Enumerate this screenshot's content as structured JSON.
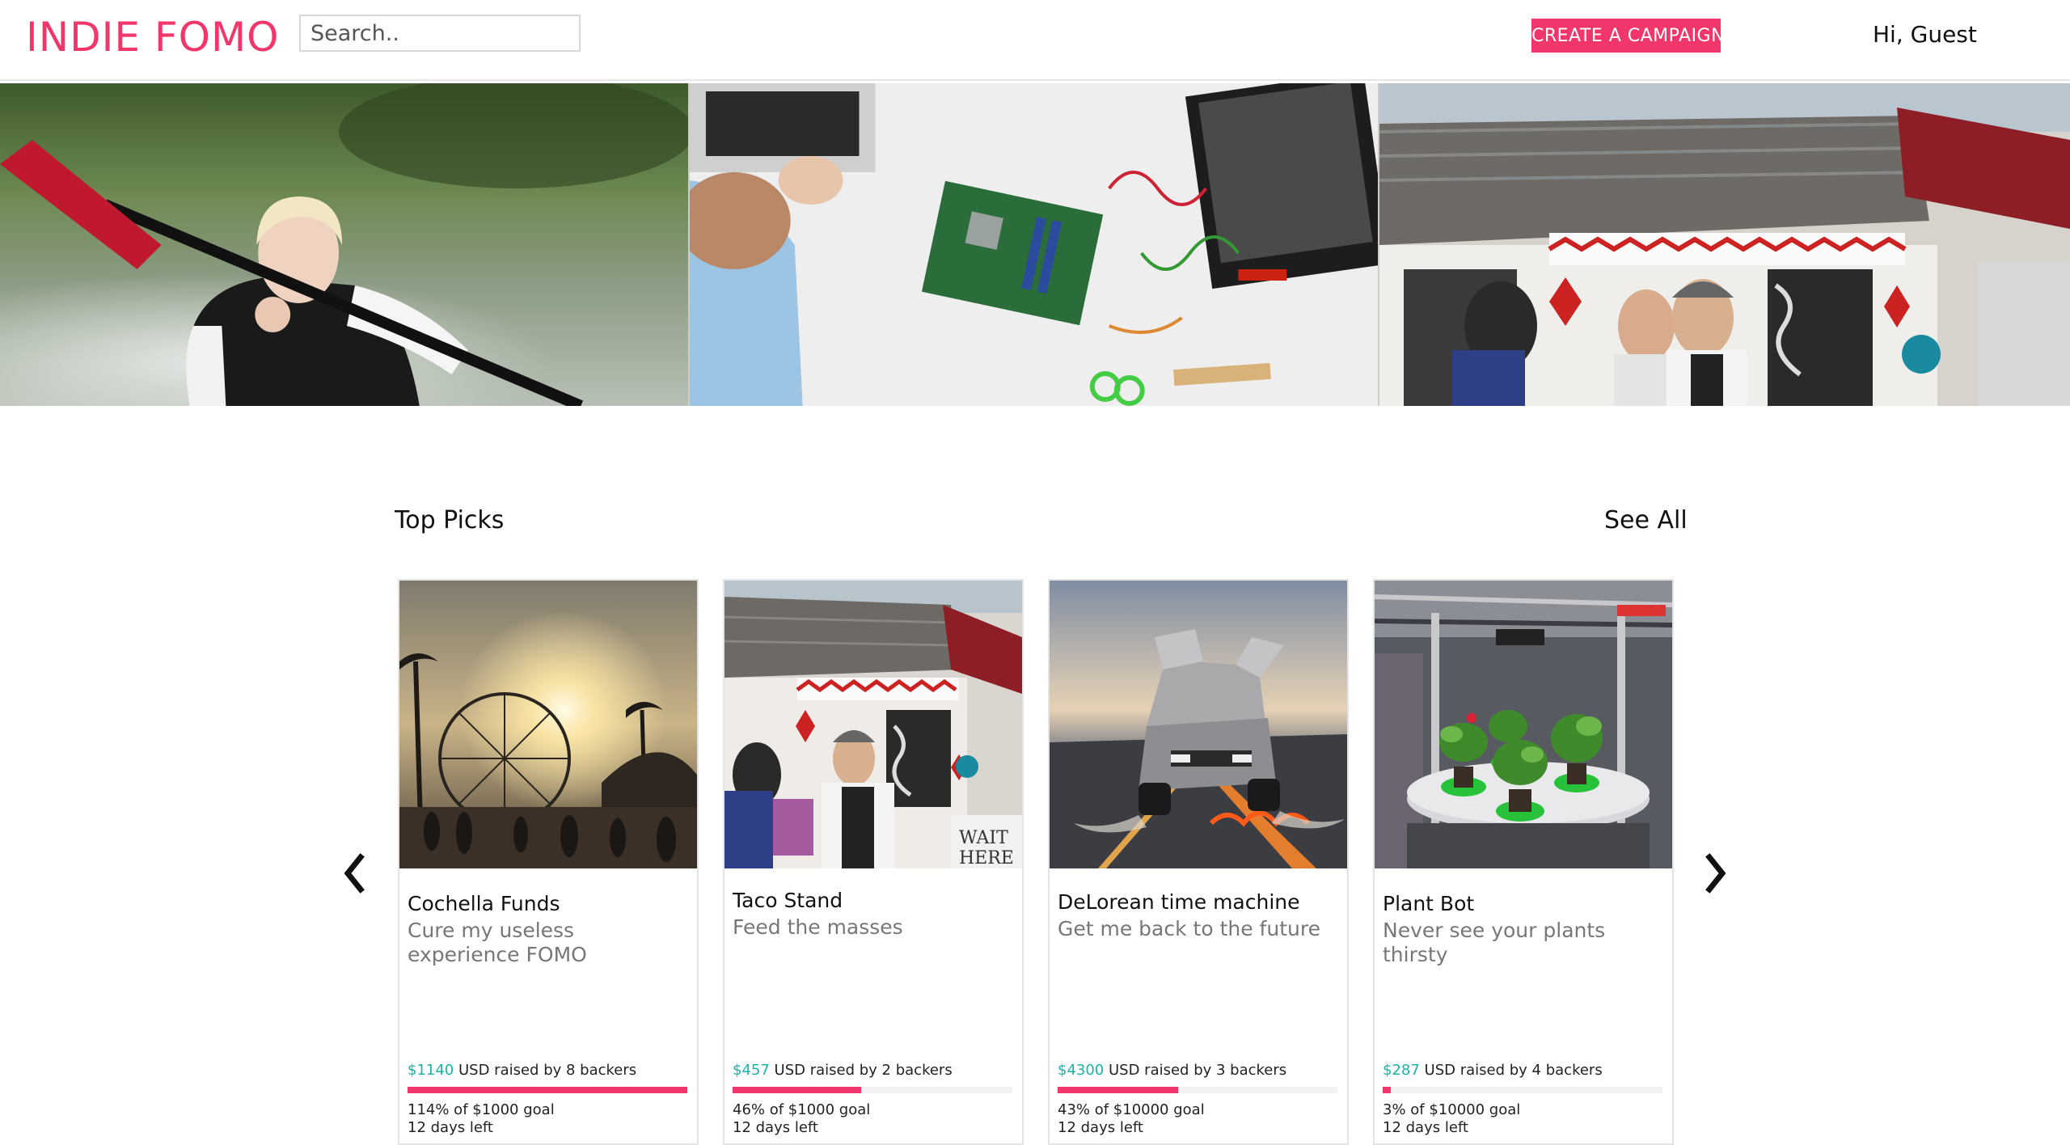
{
  "header": {
    "logo": "INDIE FOMO",
    "search_placeholder": "Search..",
    "create_campaign": "CREATE A CAMPAIGN",
    "greeting": "Hi, Guest"
  },
  "colors": {
    "brand": "#f0366b",
    "raised_amount": "#1ab3a6"
  },
  "top_picks": {
    "title": "Top Picks",
    "see_all": "See All",
    "prev_icon": "chevron-left-icon",
    "next_icon": "chevron-right-icon",
    "cards": [
      {
        "title": "Cochella Funds",
        "description": "Cure my useless experience FOMO",
        "amount": "$1140",
        "raised_suffix": " USD raised by 8 backers",
        "progress_fraction": 1.0,
        "goal": "114% of $1000 goal",
        "days_left": "12 days left"
      },
      {
        "title": "Taco Stand",
        "description": "Feed the masses",
        "amount": "$457",
        "raised_suffix": " USD raised by 2 backers",
        "progress_fraction": 0.46,
        "goal": "46% of $1000 goal",
        "days_left": "12 days left"
      },
      {
        "title": "DeLorean time machine",
        "description": "Get me back to the future",
        "amount": "$4300",
        "raised_suffix": " USD raised by 3 backers",
        "progress_fraction": 0.43,
        "goal": "43% of $10000 goal",
        "days_left": "12 days left"
      },
      {
        "title": "Plant Bot",
        "description": "Never see your plants thirsty",
        "amount": "$287",
        "raised_suffix": " USD raised by 4 backers",
        "progress_fraction": 0.03,
        "goal": "3% of $10000 goal",
        "days_left": "12 days left"
      }
    ]
  }
}
